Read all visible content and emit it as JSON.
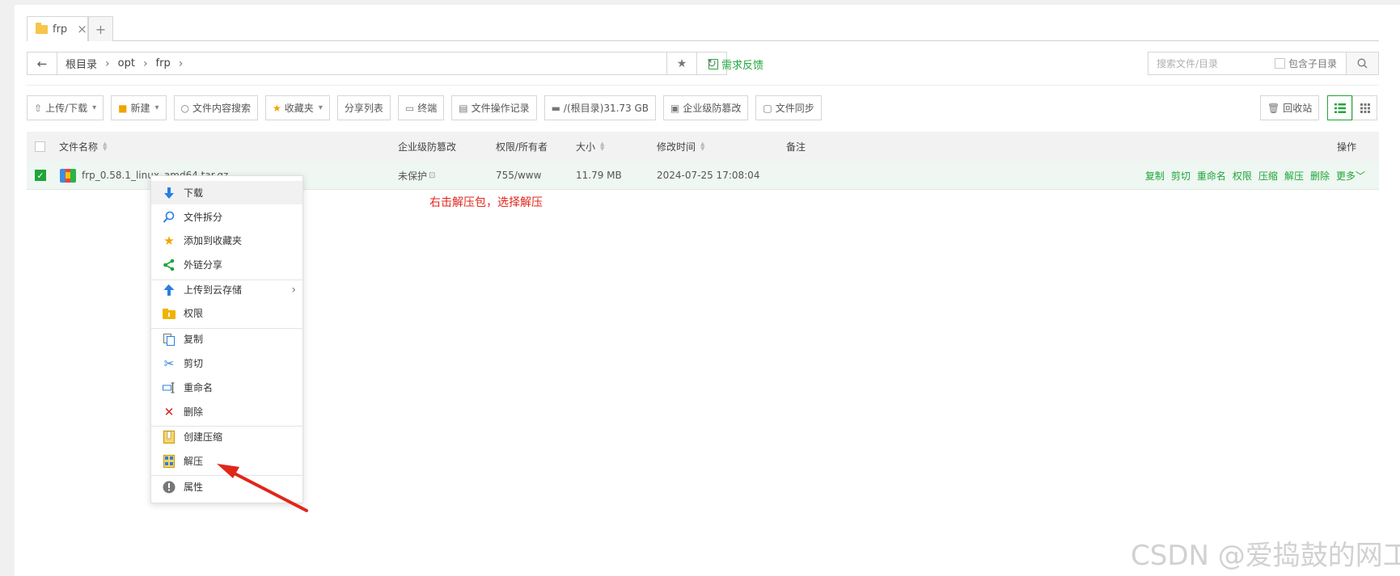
{
  "tab": {
    "label": "frp",
    "close": "×",
    "add": "+"
  },
  "address": {
    "back": "←",
    "crumbs": [
      "根目录",
      "opt",
      "frp"
    ],
    "sep": "›",
    "favorite": "★",
    "refresh": "↻"
  },
  "feedback": "需求反馈",
  "search": {
    "placeholder": "搜索文件/目录",
    "include_sub": "包含子目录"
  },
  "toolbar": [
    {
      "label": "上传/下载",
      "icon": "upload-icon",
      "caret": true
    },
    {
      "label": "新建",
      "icon": "new-folder-icon",
      "caret": true
    },
    {
      "label": "文件内容搜索",
      "icon": "search-icon",
      "caret": false
    },
    {
      "label": "收藏夹",
      "icon": "star-icon",
      "caret": true
    },
    {
      "label": "分享列表",
      "icon": "",
      "caret": false
    },
    {
      "label": "终端",
      "icon": "terminal-icon",
      "caret": false
    },
    {
      "label": "文件操作记录",
      "icon": "log-icon",
      "caret": false
    },
    {
      "label": "/(根目录)31.73 GB",
      "icon": "disk-icon",
      "caret": false
    },
    {
      "label": "企业级防篡改",
      "icon": "shield-icon",
      "caret": false
    },
    {
      "label": "文件同步",
      "icon": "sync-icon",
      "caret": false
    }
  ],
  "recycle": "回收站",
  "table": {
    "headers": {
      "name": "文件名称",
      "protect": "企业级防篡改",
      "perm": "权限/所有者",
      "size": "大小",
      "mtime": "修改时间",
      "note": "备注",
      "ops": "操作"
    },
    "row": {
      "name": "frp_0.58.1_linux_amd64.tar.gz",
      "protect": "未保护",
      "perm": "755/www",
      "size": "11.79 MB",
      "mtime": "2024-07-25 17:08:04",
      "ops": [
        "复制",
        "剪切",
        "重命名",
        "权限",
        "压缩",
        "解压",
        "删除",
        "更多"
      ]
    }
  },
  "annotation": "右击解压包，选择解压",
  "context_menu": [
    {
      "label": "下载",
      "icon": "download-icon",
      "color": "#2a7de1"
    },
    {
      "label": "文件拆分",
      "icon": "file-split-icon",
      "color": "#2a7de1"
    },
    {
      "label": "添加到收藏夹",
      "icon": "star-icon",
      "color": "#f0a400"
    },
    {
      "label": "外链分享",
      "icon": "share-icon",
      "color": "#20a53a"
    },
    {
      "label": "上传到云存储",
      "icon": "cloud-upload-icon",
      "color": "#2a7de1"
    },
    {
      "label": "权限",
      "icon": "permission-icon",
      "color": "#f0b400"
    },
    {
      "label": "复制",
      "icon": "copy-icon",
      "color": "#555"
    },
    {
      "label": "剪切",
      "icon": "scissors-icon",
      "color": "#2a7de1"
    },
    {
      "label": "重命名",
      "icon": "rename-icon",
      "color": "#2a7de1"
    },
    {
      "label": "删除",
      "icon": "delete-icon",
      "color": "#d9221a"
    },
    {
      "label": "创建压缩",
      "icon": "compress-icon",
      "color": "#f0b400"
    },
    {
      "label": "解压",
      "icon": "extract-icon",
      "color": "#2a7de1"
    },
    {
      "label": "属性",
      "icon": "info-icon",
      "color": "#777"
    }
  ],
  "watermark": "CSDN @爱捣鼓的网工"
}
